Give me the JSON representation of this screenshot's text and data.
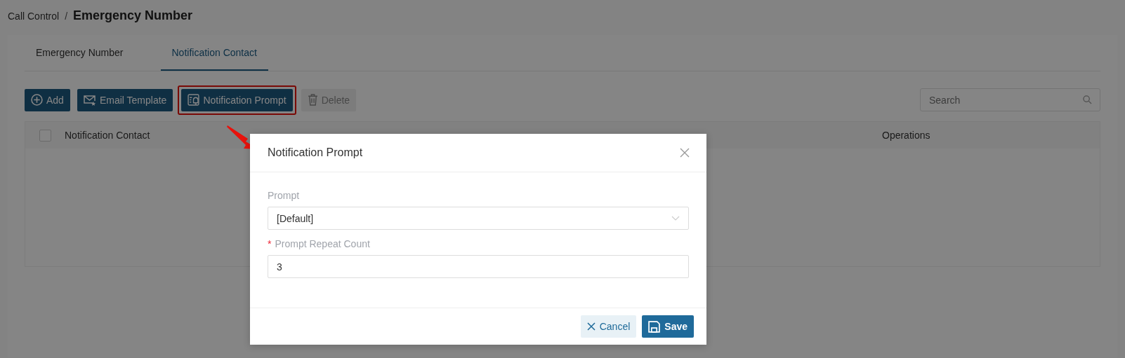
{
  "breadcrumb": {
    "parent": "Call Control",
    "separator": "/",
    "current": "Emergency Number"
  },
  "tabs": [
    {
      "label": "Emergency Number",
      "selected": false
    },
    {
      "label": "Notification Contact",
      "selected": true
    }
  ],
  "toolbar": [
    {
      "kind": "add",
      "label": "Add",
      "disabled": false,
      "highlighted": false
    },
    {
      "kind": "email",
      "label": "Email Template",
      "disabled": false,
      "highlighted": false
    },
    {
      "kind": "prompt",
      "label": "Notification Prompt",
      "disabled": false,
      "highlighted": true
    },
    {
      "kind": "delete",
      "label": "Delete",
      "disabled": true,
      "highlighted": false
    }
  ],
  "search": {
    "placeholder": "Search"
  },
  "table": {
    "select_all": {
      "checked": false
    },
    "columns": [
      "Notification Contact",
      "Operations"
    ]
  },
  "dialog": {
    "title": "Notification Prompt",
    "fields": [
      {
        "kind": "select",
        "label": "Prompt",
        "required": false,
        "value": "[Default]"
      },
      {
        "kind": "input",
        "label": "Prompt Repeat Count",
        "required": true,
        "required_mark": "*",
        "value": "3"
      }
    ],
    "buttons": [
      {
        "kind": "cancel",
        "label": "Cancel"
      },
      {
        "kind": "save",
        "label": "Save"
      }
    ]
  }
}
